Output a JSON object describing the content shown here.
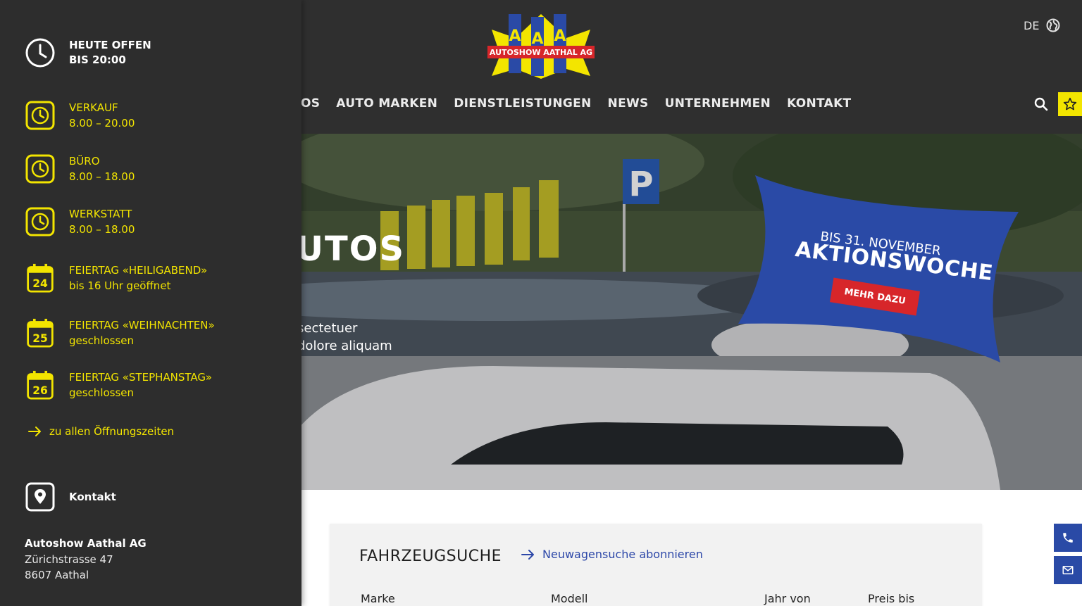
{
  "header": {
    "logo": {
      "letters": [
        "A",
        "A",
        "A"
      ],
      "name": "AUTOSHOW AATHAL AG"
    },
    "language": "DE",
    "nav": [
      "OS",
      "AUTO MARKEN",
      "DIENSTLEISTUNGEN",
      "NEWS",
      "UNTERNEHMEN",
      "KONTAKT"
    ]
  },
  "hero": {
    "title": "UTOS",
    "text_line1": "sectetuer",
    "text_line2": "dolore aliquam",
    "badge": {
      "subtitle": "BIS 31. NOVEMBER",
      "title": "AKTIONSWOCHE",
      "button": "MEHR DAZU"
    }
  },
  "search": {
    "title": "FAHRZEUGSUCHE",
    "subscribe_link": "Neuwagensuche abonnieren",
    "fields": [
      "Marke",
      "Modell",
      "Jahr von",
      "Preis bis"
    ]
  },
  "panel": {
    "today": {
      "line1": "HEUTE OFFEN",
      "line2": "BIS 20:00"
    },
    "hours": [
      {
        "title": "VERKAUF",
        "time": "8.00 – 20.00"
      },
      {
        "title": "BÜRO",
        "time": "8.00 – 18.00"
      },
      {
        "title": "WERKSTATT",
        "time": "8.00 – 18.00"
      }
    ],
    "holidays": [
      {
        "day": "24",
        "title": "FEIERTAG «HEILIGABEND»",
        "note": "bis 16 Uhr geöffnet"
      },
      {
        "day": "25",
        "title": "FEIERTAG «WEIHNACHTEN»",
        "note": "geschlossen"
      },
      {
        "day": "26",
        "title": "FEIERTAG «STEPHANSTAG»",
        "note": "geschlossen"
      }
    ],
    "all_hours_link": "zu allen Öffnungszeiten",
    "contact_label": "Kontakt",
    "address": {
      "company": "Autoshow Aathal AG",
      "street": "Zürichstrasse 47",
      "city": "8607 Aathal"
    }
  },
  "colors": {
    "accent_yellow": "#f3e500",
    "brand_blue": "#2a4aa6",
    "badge_red": "#d7262a",
    "panel_bg": "#2d2d2d"
  }
}
